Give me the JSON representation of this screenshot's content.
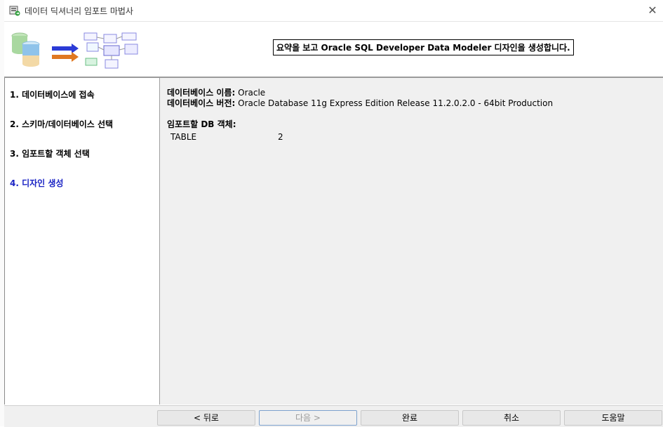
{
  "window": {
    "title": "데이터 딕셔너리 임포트 마법사"
  },
  "banner": {
    "text": "요약을 보고 Oracle SQL Developer Data Modeler 디자인을 생성합니다."
  },
  "steps": [
    {
      "label": "1. 데이터베이스에 접속",
      "active": false
    },
    {
      "label": "2. 스키마/데이터베이스 선택",
      "active": false
    },
    {
      "label": "3. 임포트할 객체 선택",
      "active": false
    },
    {
      "label": "4. 디자인 생성",
      "active": true
    }
  ],
  "summary": {
    "db_name_label": "데이터베이스 이름:",
    "db_name_value": "Oracle",
    "db_version_label": "데이터베이스 버전:",
    "db_version_value": "Oracle Database 11g Express Edition Release 11.2.0.2.0 - 64bit Production",
    "objects_label": "임포트할 DB 객체:",
    "objects": [
      {
        "name": "TABLE",
        "count": "2"
      }
    ]
  },
  "footer": {
    "back_label": "< 뒤로",
    "next_label": "다음 >",
    "finish_label": "완료",
    "cancel_label": "취소",
    "help_label": "도움말"
  },
  "colors": {
    "active_step": "#1a23c4",
    "content_bg": "#f0f0f0",
    "arrow_blue": "#2b3bd6",
    "arrow_orange": "#e07820",
    "db_green": "#a9d8a0",
    "db_blue": "#8fc3ea"
  },
  "icons": {
    "app": "database-import-icon",
    "close": "close-icon",
    "banner": "import-wizard-graphic"
  }
}
